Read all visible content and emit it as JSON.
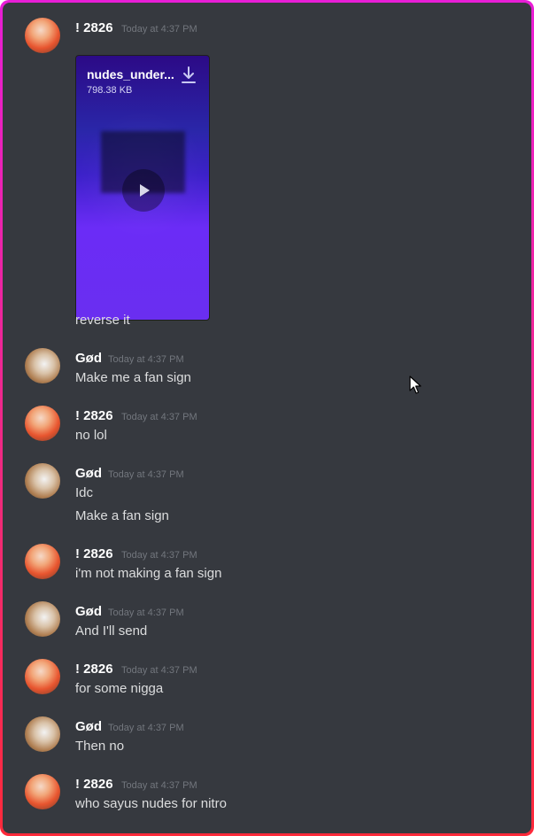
{
  "users": {
    "u2826": "! 2826",
    "god": "Gød"
  },
  "attachment": {
    "filename": "nudes_under...",
    "size": "798.38 KB"
  },
  "messages": [
    {
      "author": "! 2826",
      "time": "Today at 4:37 PM",
      "lines": [
        "reverse it"
      ]
    },
    {
      "author": "Gød",
      "time": "Today at 4:37 PM",
      "lines": [
        "Make me a fan sign"
      ]
    },
    {
      "author": "! 2826",
      "time": "Today at 4:37 PM",
      "lines": [
        "no lol"
      ]
    },
    {
      "author": "Gød",
      "time": "Today at 4:37 PM",
      "lines": [
        "Idc",
        "Make a fan sign"
      ]
    },
    {
      "author": "! 2826",
      "time": "Today at 4:37 PM",
      "lines": [
        "i'm not making a fan sign"
      ]
    },
    {
      "author": "Gød",
      "time": "Today at 4:37 PM",
      "lines": [
        "And I'll send"
      ]
    },
    {
      "author": "! 2826",
      "time": "Today at 4:37 PM",
      "lines": [
        "for some nigga"
      ]
    },
    {
      "author": "Gød",
      "time": "Today at 4:37 PM",
      "lines": [
        "Then no"
      ]
    },
    {
      "author": "! 2826",
      "time": "Today at 4:37 PM",
      "lines": [
        "who sayus nudes for nitro"
      ]
    }
  ],
  "icons": {
    "download": "download-icon",
    "play": "play-icon",
    "cursor": "mouse-cursor-icon"
  },
  "colors": {
    "background": "#36393f",
    "username": "#ffffff",
    "timestamp": "#72767d",
    "message_text": "#dcddde",
    "frame_top": "#e81ed6",
    "frame_bottom": "#ff2a3a"
  }
}
